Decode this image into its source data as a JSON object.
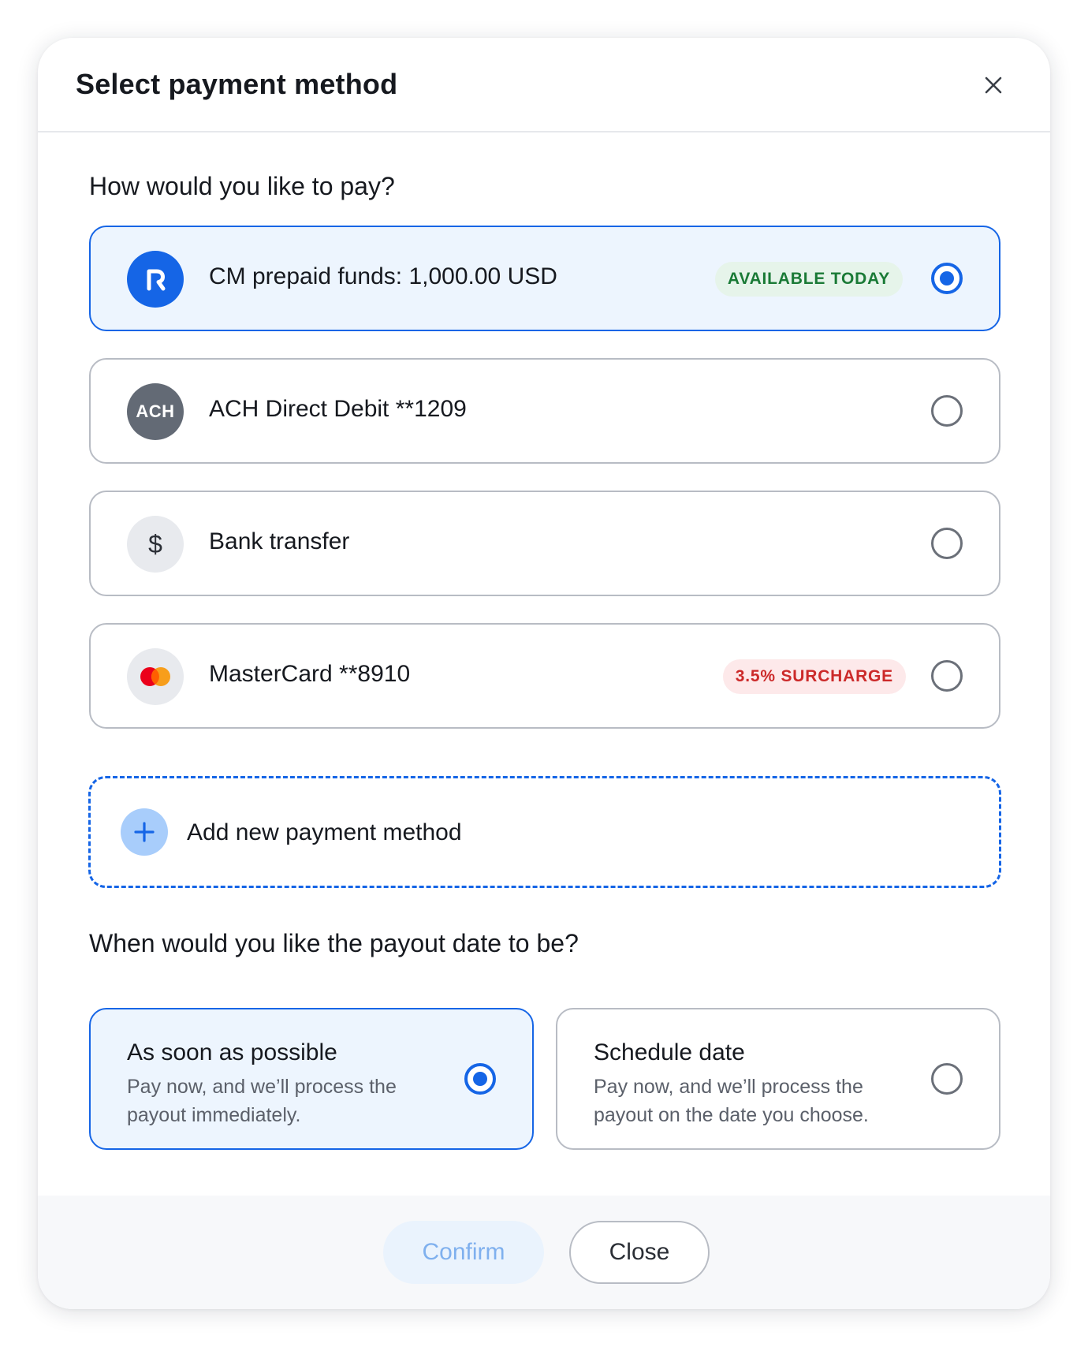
{
  "modal": {
    "title": "Select payment method"
  },
  "payment_section": {
    "title": "How would you like to pay?",
    "methods": [
      {
        "label": "CM prepaid funds: 1,000.00 USD",
        "icon": "brand-r-logo-icon",
        "badge": "AVAILABLE TODAY",
        "selected": true
      },
      {
        "label": "ACH Direct Debit **1209",
        "icon_text": "ACH",
        "badge": "",
        "selected": false
      },
      {
        "label": "Bank transfer",
        "icon_text": "$",
        "badge": "",
        "selected": false
      },
      {
        "label": "MasterCard **8910",
        "icon": "mastercard-icon",
        "badge": "3.5% SURCHARGE",
        "selected": false
      }
    ],
    "add_label": "Add new payment method"
  },
  "payout_section": {
    "title": "When would you like the payout date to be?",
    "options": [
      {
        "title": "As soon as possible",
        "description": "Pay now, and we’ll process the payout immediately.",
        "selected": true
      },
      {
        "title": "Schedule date",
        "description": "Pay now, and we’ll process the payout on the date you choose.",
        "selected": false
      }
    ]
  },
  "footer": {
    "confirm_label": "Confirm",
    "close_label": "Close"
  },
  "colors": {
    "accent": "#1565e6",
    "selected_bg": "#edf5fe",
    "available_badge_text": "#1a7a36",
    "surcharge_badge_text": "#cc2a2a",
    "mastercard_red": "#eb001b",
    "mastercard_orange": "#f79e1b"
  }
}
